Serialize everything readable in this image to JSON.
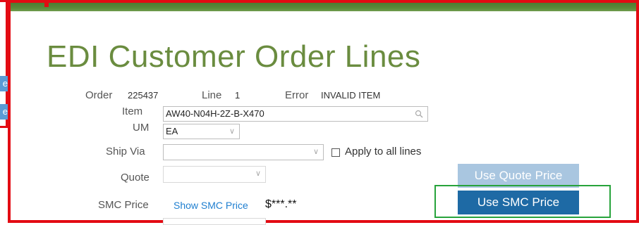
{
  "page": {
    "title": "EDI Customer Order Lines"
  },
  "side_buttons": [
    "e",
    "e"
  ],
  "order": {
    "label": "Order",
    "value": "225437"
  },
  "line": {
    "label": "Line",
    "value": "1"
  },
  "error": {
    "label": "Error",
    "value": "INVALID ITEM"
  },
  "item": {
    "label": "Item",
    "value": "AW40-N04H-2Z-B-X470"
  },
  "um": {
    "label": "UM",
    "value": "EA"
  },
  "ship_via": {
    "label": "Ship Via",
    "value": "",
    "apply_all_label": "Apply to all lines"
  },
  "quote": {
    "label": "Quote",
    "value": ""
  },
  "smc_price": {
    "label": "SMC Price",
    "link": "Show SMC Price",
    "value": "$***.**"
  },
  "buttons": {
    "use_quote_price": "Use Quote Price",
    "use_smc_price": "Use SMC Price"
  },
  "colors": {
    "title_green": "#6a8c3f",
    "annotation_red": "#e30b13",
    "highlight_green": "#27a33b",
    "button_blue": "#1e6aa5",
    "button_light_blue": "#a9c6e0",
    "link_blue": "#1f7fd0"
  }
}
